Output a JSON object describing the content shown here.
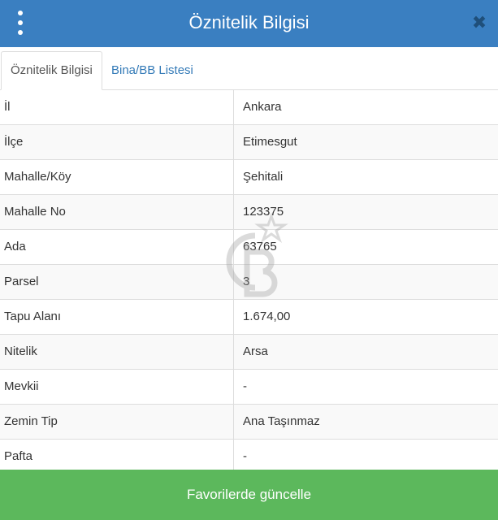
{
  "header": {
    "title": "Öznitelik Bilgisi",
    "menu_icon": "kebab-menu-icon",
    "close_icon": "close-icon",
    "close_glyph": "✖",
    "background_color": "#3a7fc1"
  },
  "tabs": [
    {
      "label": "Öznitelik Bilgisi",
      "active": true
    },
    {
      "label": "Bina/BB Listesi",
      "active": false
    }
  ],
  "attributes": {
    "columns": [
      "key",
      "value"
    ],
    "rows": [
      {
        "key": "İl",
        "value": "Ankara"
      },
      {
        "key": "İlçe",
        "value": "Etimesgut"
      },
      {
        "key": "Mahalle/Köy",
        "value": "Şehitali"
      },
      {
        "key": "Mahalle No",
        "value": "123375"
      },
      {
        "key": "Ada",
        "value": "63765"
      },
      {
        "key": "Parsel",
        "value": "3"
      },
      {
        "key": "Tapu Alanı",
        "value": "1.674,00"
      },
      {
        "key": "Nitelik",
        "value": "Arsa"
      },
      {
        "key": "Mevkii",
        "value": "-"
      },
      {
        "key": "Zemin Tip",
        "value": "Ana Taşınmaz"
      },
      {
        "key": "Pafta",
        "value": "-"
      }
    ]
  },
  "watermark": {
    "icon": "cb-star-logo-icon"
  },
  "footer": {
    "button_label": "Favorilerde güncelle",
    "background_color": "#5cb85c"
  }
}
